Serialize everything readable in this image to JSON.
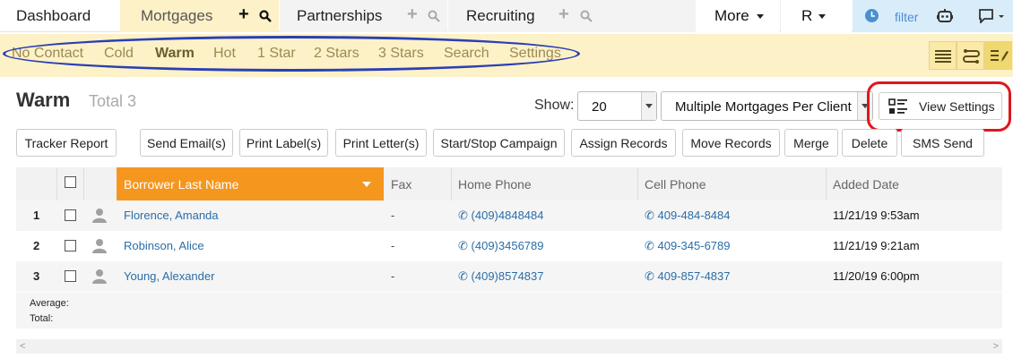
{
  "nav": {
    "tabs": [
      {
        "label": "Dashboard"
      },
      {
        "label": "Mortgages",
        "plus": "+"
      },
      {
        "label": "Partnerships",
        "plus": "+"
      },
      {
        "label": "Recruiting",
        "plus": "+"
      }
    ],
    "more_label": "More",
    "user_label": "R",
    "filter_label": "filter"
  },
  "subnav": {
    "items": [
      "No Contact",
      "Cold",
      "Warm",
      "Hot",
      "1 Star",
      "2 Stars",
      "3 Stars",
      "Search",
      "Settings"
    ],
    "active": "Warm"
  },
  "header": {
    "title": "Warm",
    "total": "Total 3",
    "show_label": "Show:",
    "show_value": "20",
    "view_mode": "Multiple Mortgages Per Client",
    "view_settings_label": "View Settings"
  },
  "actions": [
    "Tracker Report",
    "Send Email(s)",
    "Print Label(s)",
    "Print Letter(s)",
    "Start/Stop Campaign",
    "Assign Records",
    "Move Records",
    "Merge",
    "Delete",
    "SMS Send"
  ],
  "table": {
    "columns": [
      "Borrower Last Name",
      "Fax",
      "Home Phone",
      "Cell Phone",
      "Added Date"
    ],
    "rows": [
      {
        "num": "1",
        "name": "Florence, Amanda",
        "fax": "-",
        "home": "(409)4848484",
        "cell": "409-484-8484",
        "added": "11/21/19 9:53am"
      },
      {
        "num": "2",
        "name": "Robinson, Alice",
        "fax": "-",
        "home": "(409)3456789",
        "cell": "409-345-6789",
        "added": "11/21/19 9:21am"
      },
      {
        "num": "3",
        "name": "Young, Alexander",
        "fax": "-",
        "home": "(409)8574837",
        "cell": "409-857-4837",
        "added": "11/20/19 6:00pm"
      }
    ],
    "footer": {
      "average_label": "Average:",
      "total_label": "Total:"
    }
  },
  "colors": {
    "accent": "#f5961e",
    "subnav_bg": "#fdf1c7",
    "link": "#2a6ea8",
    "highlight_blue": "#2a3fb5",
    "highlight_red": "#e0161c"
  },
  "icons": [
    "search-icon",
    "plus-icon",
    "clock-icon",
    "robot-icon",
    "chat-icon",
    "list-view-icon",
    "route-view-icon",
    "edit-list-icon",
    "view-settings-icon",
    "person-icon",
    "phone-icon"
  ]
}
